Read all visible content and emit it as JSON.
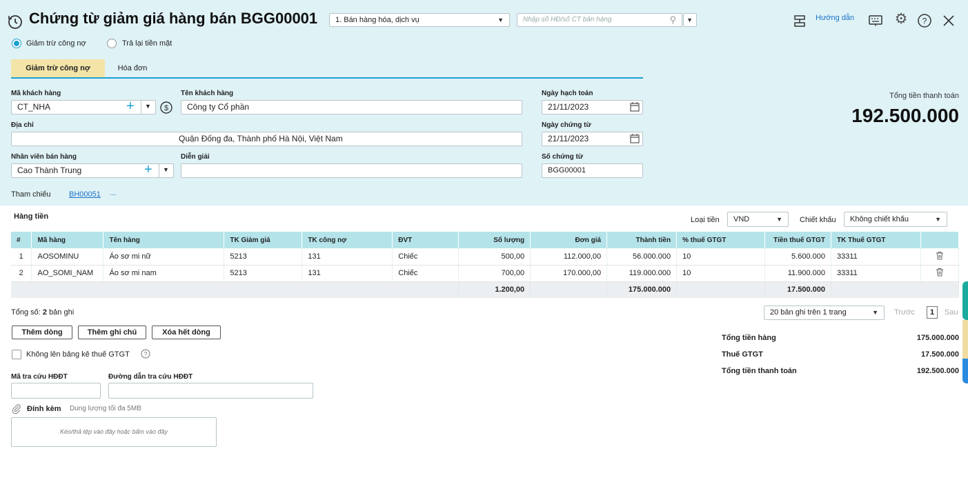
{
  "header": {
    "title": "Chứng từ giảm giá hàng bán BGG00001",
    "type_select": "1. Bán hàng hóa, dịch vụ",
    "invoice_search_placeholder": "Nhập số HĐ/số CT bán hàng",
    "help_label": "Hướng dẫn"
  },
  "radios": {
    "option1": "Giảm trừ công nợ",
    "option2": "Trả lại tiền mặt",
    "selected": "option1"
  },
  "tabs": [
    {
      "label": "Giảm trừ công nợ"
    },
    {
      "label": "Hóa đơn"
    }
  ],
  "form": {
    "customer_code_label": "Mã khách hàng",
    "customer_code": "CT_NHA",
    "customer_name_label": "Tên khách hàng",
    "customer_name": "Công ty Cổ phần",
    "address_label": "Địa chỉ",
    "address": "Quận Đống đa, Thành phố Hà Nội, Việt Nam",
    "salesperson_label": "Nhân viên bán hàng",
    "salesperson": "Cao Thành Trung",
    "description_label": "Diễn giải",
    "description": "",
    "posting_date_label": "Ngày hạch toán",
    "posting_date": "21/11/2023",
    "voucher_date_label": "Ngày chứng từ",
    "voucher_date": "21/11/2023",
    "voucher_no_label": "Số chứng từ",
    "voucher_no": "BGG00001",
    "reference_label": "Tham chiếu",
    "reference_link": "BH00051",
    "reference_more": "..."
  },
  "total_box": {
    "label": "Tổng tiền thanh toán",
    "value": "192.500.000"
  },
  "grid_section": {
    "title": "Hàng tiền",
    "currency_label": "Loại tiền",
    "currency": "VND",
    "discount_label": "Chiết khấu",
    "discount": "Không chiết khấu"
  },
  "table": {
    "columns": [
      "#",
      "Mã hàng",
      "Tên hàng",
      "TK Giảm giá",
      "TK công nợ",
      "ĐVT",
      "Số lượng",
      "Đơn giá",
      "Thành tiền",
      "% thuế GTGT",
      "Tiền thuế GTGT",
      "TK Thuế GTGT"
    ],
    "rows": [
      {
        "no": "1",
        "code": "AOSOMINU",
        "name": "Áo sơ mi nữ",
        "tk_discount": "5213",
        "tk_debt": "131",
        "unit": "Chiếc",
        "qty": "500,00",
        "price": "112.000,00",
        "amount": "56.000.000",
        "vat_pct": "10",
        "vat_amount": "5.600.000",
        "tk_vat": "33311"
      },
      {
        "no": "2",
        "code": "AO_SOMI_NAM",
        "name": "Áo sơ mi nam",
        "tk_discount": "5213",
        "tk_debt": "131",
        "unit": "Chiếc",
        "qty": "700,00",
        "price": "170.000,00",
        "amount": "119.000.000",
        "vat_pct": "10",
        "vat_amount": "11.900.000",
        "tk_vat": "33311"
      }
    ],
    "totals": {
      "qty": "1.200,00",
      "amount": "175.000.000",
      "vat_amount": "17.500.000"
    }
  },
  "footer": {
    "record_count_prefix": "Tổng số:",
    "record_count": "2",
    "record_count_suffix": "bản ghi",
    "page_size": "20 bản ghi trên 1 trang",
    "prev_label": "Trước",
    "page": "1",
    "next_label": "Sau",
    "add_row": "Thêm dòng",
    "add_note": "Thêm ghi chú",
    "delete_all": "Xóa hết dòng",
    "no_vat_list": "Không lên bảng kê thuế GTGT",
    "einvoice_code_label": "Mã tra cứu HĐĐT",
    "einvoice_link_label": "Đường dẫn tra cứu HĐĐT",
    "attach_label": "Đính kèm",
    "attach_hint": "Dung lượng tối đa 5MB",
    "drop_hint": "Kéo/thả tệp vào đây hoặc bấm vào đây"
  },
  "summary": {
    "goods_label": "Tổng tiền hàng",
    "goods_value": "175.000.000",
    "vat_label": "Thuế GTGT",
    "vat_value": "17.500.000",
    "total_label": "Tổng tiền thanh toán",
    "total_value": "192.500.000"
  },
  "colors": {
    "header_bg": "#dff2f6",
    "table_header_bg": "#b4e4ea",
    "active_tab_bg": "#f3e4a8",
    "accent": "#1a9fd0",
    "link": "#1a73c6"
  }
}
